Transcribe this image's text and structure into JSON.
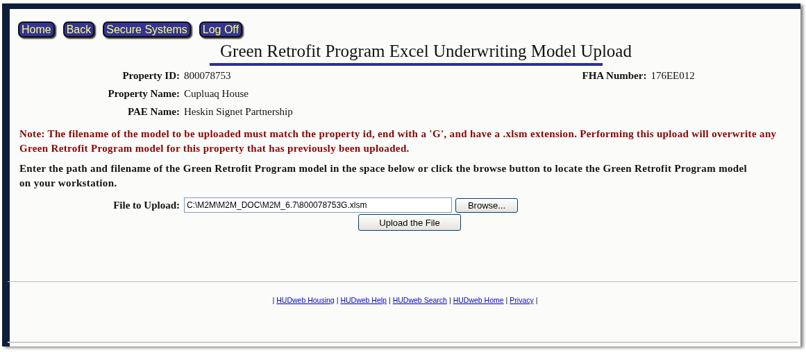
{
  "nav_buttons": [
    "Home",
    "Back",
    "Secure Systems",
    "Log Off"
  ],
  "title": "Green Retrofit Program Excel Underwriting Model Upload",
  "property_fields": [
    {
      "label": "Property ID:",
      "value": "800078753"
    },
    {
      "label": "Property Name:",
      "value": "Cupluaq House"
    },
    {
      "label": "PAE Name:",
      "value": "Heskin Signet Partnership"
    }
  ],
  "fha_field": {
    "label": "FHA Number:",
    "value": "176EE012"
  },
  "note": "Note: The filename of the model to be uploaded must match the property id, end with a 'G', and have a .xlsm extension. Performing this upload will overwrite any Green Retrofit Program model for this property that has previously been uploaded.",
  "instructions": "Enter the path and filename of the Green Retrofit Program model in the space below or click the browse button to locate the Green Retrofit Program model on your workstation.",
  "file_upload": {
    "label": "File to Upload:",
    "value": "C:\\M2M\\M2M_DOC\\M2M_6.7\\800078753G.xlsm",
    "browse_button": "Browse...",
    "upload_button": "Upload the File"
  },
  "footer": [
    {
      "kind": "separator",
      "text": "|"
    },
    {
      "kind": "link",
      "text": "HUDweb Housing"
    },
    {
      "kind": "separator",
      "text": "|"
    },
    {
      "kind": "link",
      "text": "HUDweb Help"
    },
    {
      "kind": "separator",
      "text": "|"
    },
    {
      "kind": "link",
      "text": "HUDweb Search"
    },
    {
      "kind": "separator",
      "text": "|"
    },
    {
      "kind": "link",
      "text": "HUDweb Home"
    },
    {
      "kind": "separator",
      "text": "|"
    },
    {
      "kind": "link",
      "text": "Privacy"
    },
    {
      "kind": "separator",
      "text": "|"
    }
  ]
}
